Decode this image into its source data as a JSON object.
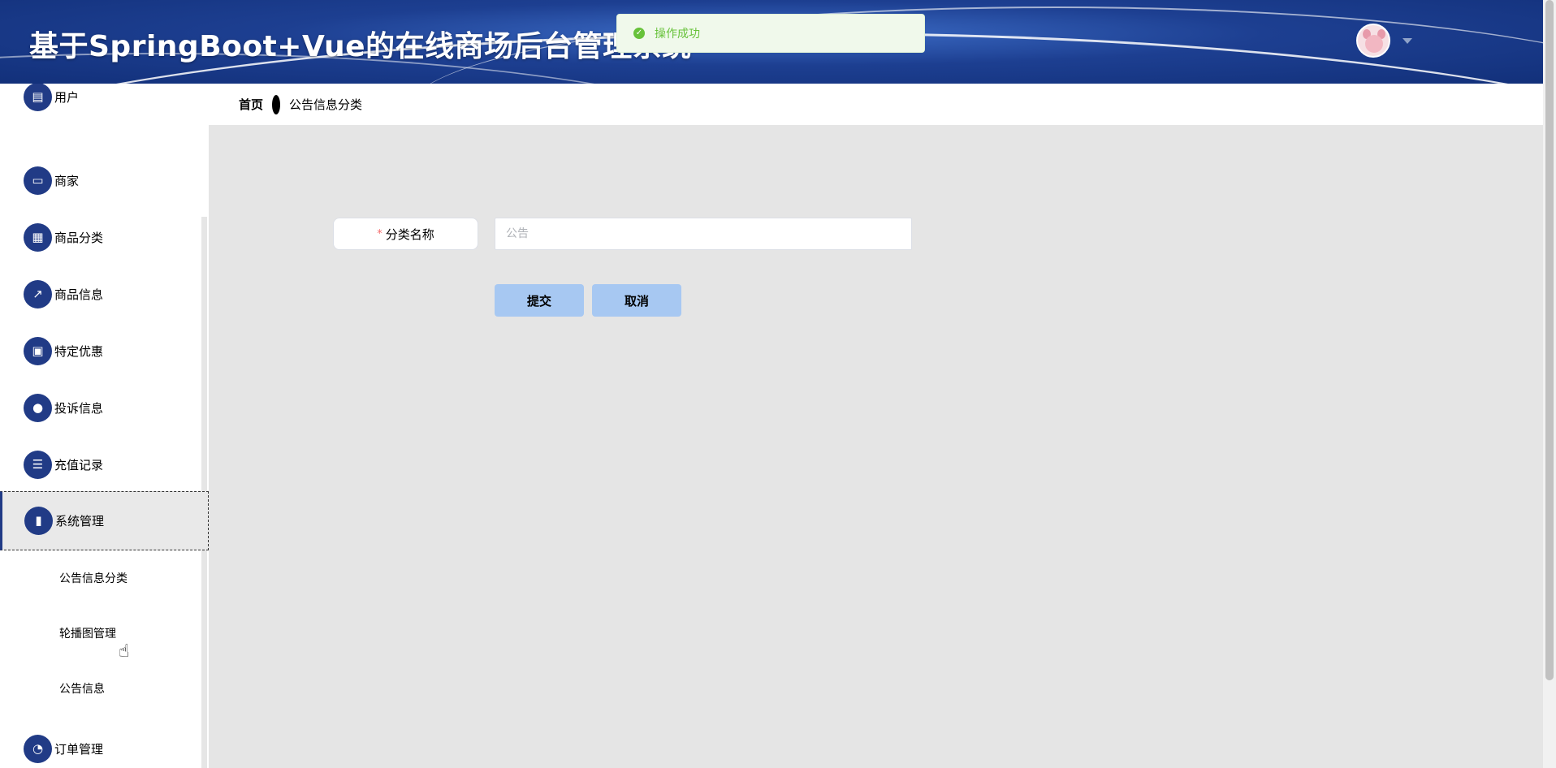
{
  "header": {
    "title": "基于SpringBoot+Vue的在线商场后台管理系统"
  },
  "toast": {
    "message": "操作成功",
    "color": "#67c23a"
  },
  "breadcrumb": {
    "home": "首页",
    "current": "公告信息分类"
  },
  "sidebar": {
    "items": [
      {
        "label": "用户",
        "icon": "list-icon"
      },
      {
        "label": "商家",
        "icon": "monitor-icon"
      },
      {
        "label": "商品分类",
        "icon": "grid-icon"
      },
      {
        "label": "商品信息",
        "icon": "chart-line-icon"
      },
      {
        "label": "特定优惠",
        "icon": "clipboard-icon"
      },
      {
        "label": "投诉信息",
        "icon": "user-icon"
      },
      {
        "label": "充值记录",
        "icon": "tickets-icon"
      },
      {
        "label": "系统管理",
        "icon": "bar-chart-icon"
      },
      {
        "label": "订单管理",
        "icon": "bulb-icon"
      }
    ],
    "submenu": [
      {
        "label": "公告信息分类"
      },
      {
        "label": "轮播图管理"
      },
      {
        "label": "公告信息"
      }
    ]
  },
  "form": {
    "label": "分类名称",
    "required_mark": "*",
    "input_placeholder": "公告",
    "submit_label": "提交",
    "cancel_label": "取消"
  },
  "colors": {
    "header": "#1d3f91",
    "menu_icon": "#213b86",
    "button": "#a7c8f2"
  }
}
